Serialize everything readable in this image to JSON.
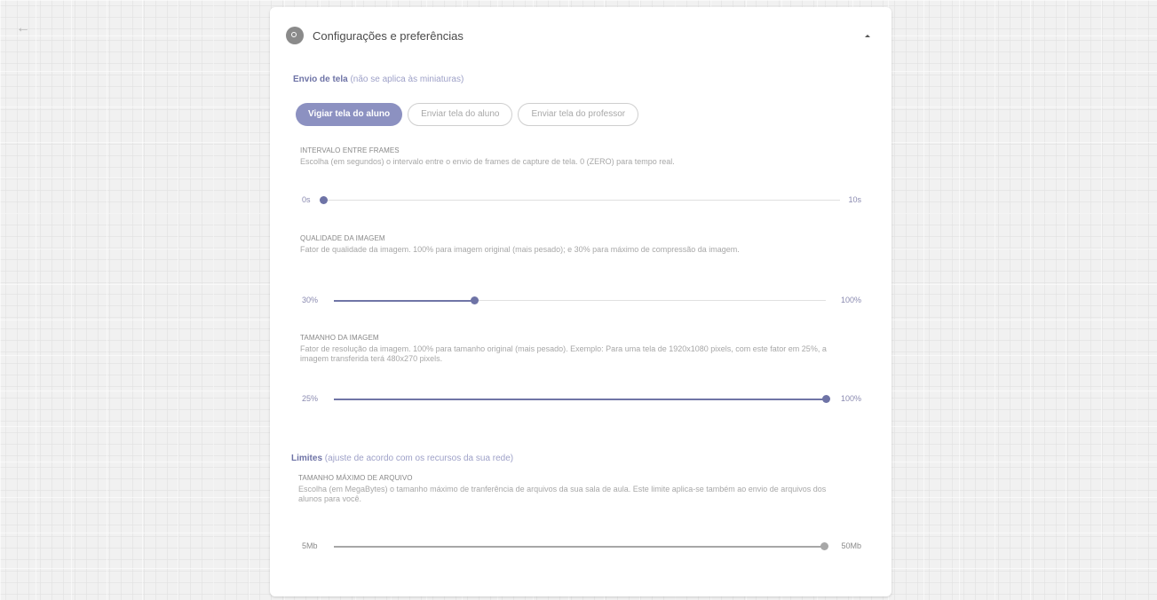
{
  "nav": {
    "back_icon": "arrow-left-icon"
  },
  "card": {
    "title": "Configurações e preferências",
    "icon": "settings-icon"
  },
  "screen_section": {
    "title": "Envio de tela",
    "note": "(não se aplica às miniaturas)",
    "tabs": [
      {
        "label": "Vigiar tela do aluno",
        "active": true
      },
      {
        "label": "Enviar tela do aluno",
        "active": false
      },
      {
        "label": "Enviar tela do professor",
        "active": false
      }
    ]
  },
  "interval": {
    "title": "INTERVALO ENTRE FRAMES",
    "desc": "Escolha (em segundos) o intervalo entre o envio de frames de capture de tela. 0 (ZERO) para tempo real.",
    "min_label": "0s",
    "max_label": "10s",
    "min": 0,
    "max": 10,
    "value": 0
  },
  "quality": {
    "title": "QUALIDADE DA IMAGEM",
    "desc": "Fator de qualidade da imagem. 100% para imagem original (mais pesado); e 30% para máximo de compressão da imagem.",
    "min_label": "30%",
    "max_label": "100%",
    "min": 30,
    "max": 100,
    "value": 50
  },
  "size": {
    "title": "TAMANHO DA IMAGEM",
    "desc": "Fator de resolução da imagem. 100% para tamanho original (mais pesado). Exemplo: Para uma tela de 1920x1080 pixels, com este fator em 25%, a imagem transferida terá 480x270 pixels.",
    "min_label": "25%",
    "max_label": "100%",
    "min": 25,
    "max": 100,
    "value": 100
  },
  "limits_section": {
    "title": "Limites",
    "note": "(ajuste de acordo com os recursos da sua rede)"
  },
  "filesize": {
    "title": "TAMANHO MÁXIMO DE ARQUIVO",
    "desc": "Escolha (em MegaBytes) o tamanho máximo de tranferência de arquivos da sua sala de aula. Este limite aplica-se também ao envio de arquivos dos alunos para você.",
    "min_label": "5Mb",
    "max_label": "50Mb",
    "min": 5,
    "max": 50,
    "value": 50
  },
  "colors": {
    "accent": "#6e73a6",
    "accent_light": "#8c91c1",
    "disabled": "#a7a7a7"
  }
}
